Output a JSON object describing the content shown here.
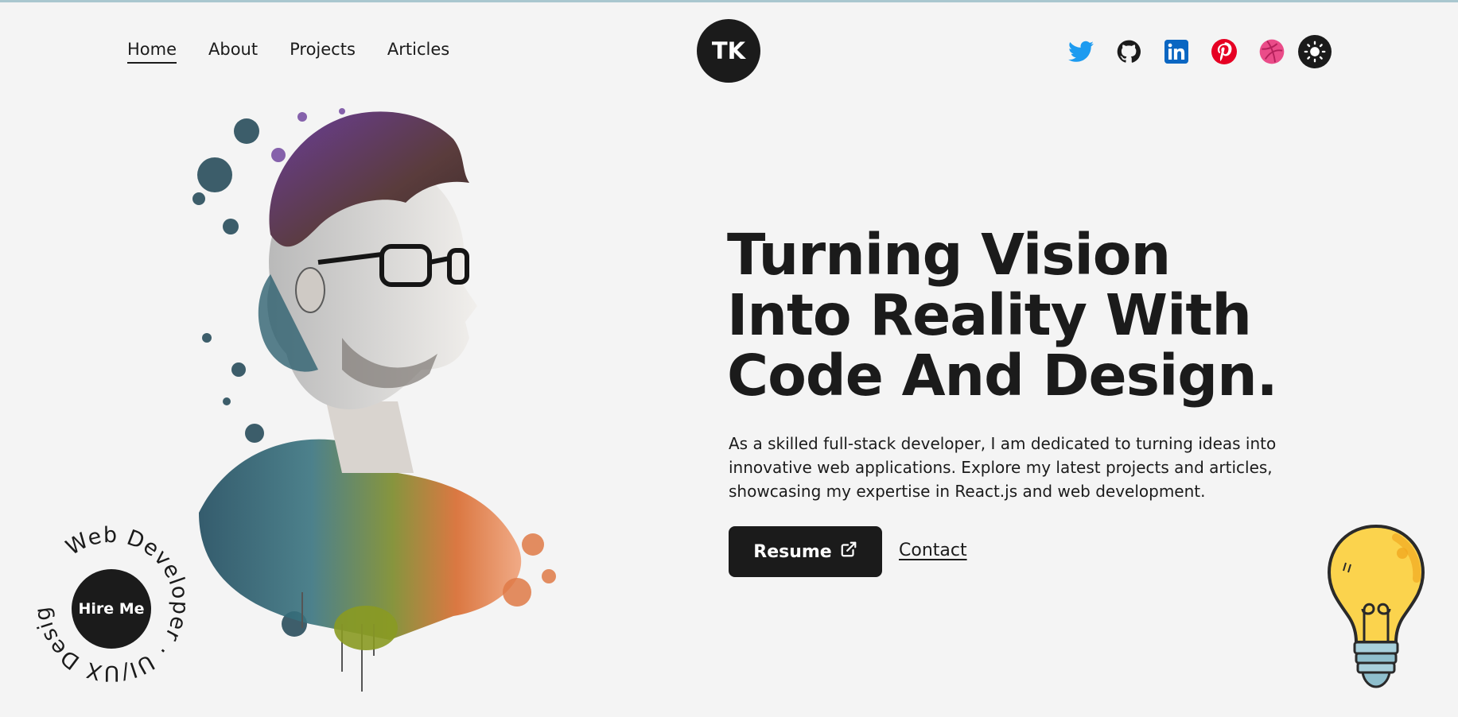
{
  "nav": {
    "items": [
      {
        "label": "Home",
        "active": true
      },
      {
        "label": "About",
        "active": false
      },
      {
        "label": "Projects",
        "active": false
      },
      {
        "label": "Articles",
        "active": false
      }
    ]
  },
  "logo": {
    "text": "TK"
  },
  "social": {
    "icons": [
      "twitter-icon",
      "github-icon",
      "linkedin-icon",
      "pinterest-icon",
      "dribbble-icon",
      "sun-icon"
    ],
    "colors": {
      "twitter": "#1d9bf0",
      "github": "#1b1b1b",
      "linkedin": "#0a66c2",
      "pinterest": "#e60023",
      "dribbble": "#ea4c89"
    }
  },
  "hero": {
    "title_line1": "Turning Vision",
    "title_line2": "Into Reality With",
    "title_line3": "Code And Design.",
    "description": "As a skilled full-stack developer, I am dedicated to turning ideas into innovative web applications. Explore my latest projects and articles, showcasing my expertise in React.js and web development.",
    "resume_label": "Resume",
    "contact_label": "Contact"
  },
  "hire": {
    "button_label": "Hire Me",
    "ring_text": "Web Developer · UI/UX Designer · "
  },
  "colors": {
    "background": "#f4f4f4",
    "dark": "#1b1b1b",
    "bulb": "#fbd34d"
  }
}
